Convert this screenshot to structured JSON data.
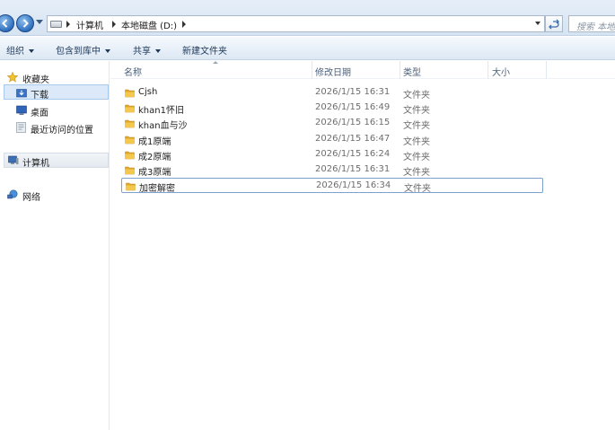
{
  "address_bar": {
    "breadcrumbs": [
      "计算机",
      "本地磁盘 (D:)"
    ],
    "search_placeholder": "搜索 本地"
  },
  "command_bar": {
    "organize": "组织",
    "include_in_library": "包含到库中",
    "share": "共享",
    "new_folder": "新建文件夹"
  },
  "nav_pane": {
    "favorites": "收藏夹",
    "downloads": "下载",
    "desktop": "桌面",
    "recent_places": "最近访问的位置",
    "computer": "计算机",
    "network": "网络"
  },
  "columns": {
    "name": "名称",
    "date_modified": "修改日期",
    "type": "类型",
    "size": "大小"
  },
  "files": [
    {
      "name": "Cjsh",
      "date": "2026/1/15 16:31",
      "type": "文件夹",
      "size": ""
    },
    {
      "name": "khan1怀旧",
      "date": "2026/1/15 16:49",
      "type": "文件夹",
      "size": ""
    },
    {
      "name": "khan血与沙",
      "date": "2026/1/15 16:15",
      "type": "文件夹",
      "size": ""
    },
    {
      "name": "成1原端",
      "date": "2026/1/15 16:47",
      "type": "文件夹",
      "size": ""
    },
    {
      "name": "成2原端",
      "date": "2026/1/15 16:24",
      "type": "文件夹",
      "size": ""
    },
    {
      "name": "成3原端",
      "date": "2026/1/15 16:31",
      "type": "文件夹",
      "size": ""
    },
    {
      "name": "加密解密",
      "date": "2026/1/15 16:34",
      "type": "文件夹",
      "size": ""
    }
  ],
  "selected_file": "加密解密",
  "colors": {
    "selection_border": "#7da2ce",
    "nav_selected_bg": "#dbe9f8",
    "folder_yellow": "#f3c84d",
    "command_text": "#1e395b"
  }
}
